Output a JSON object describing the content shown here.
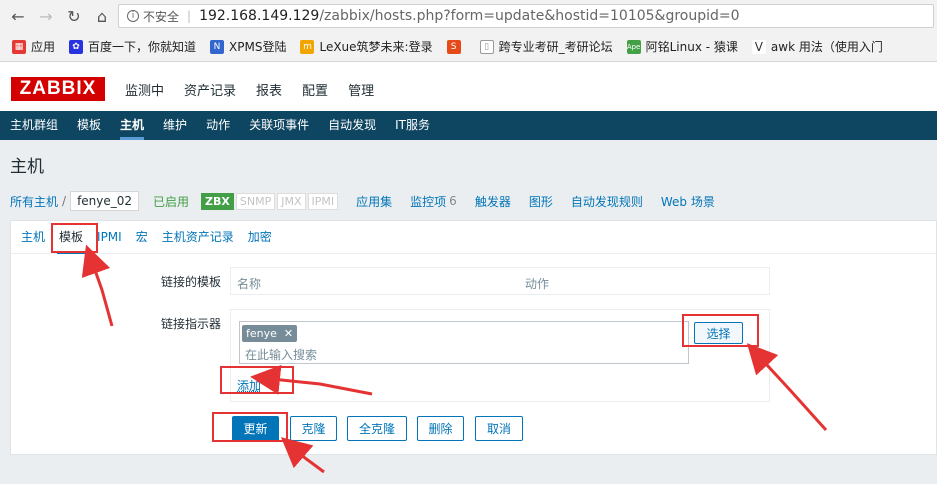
{
  "browser": {
    "insecure_label": "不安全",
    "url_host": "192.168.149.129",
    "url_path": "/zabbix/hosts.php?form=update&hostid=10105&groupid=0",
    "bookmarks": [
      {
        "label": "应用",
        "color": "#e53935",
        "icon": "apps-icon"
      },
      {
        "label": "百度一下，你就知道",
        "color": "#2932e1",
        "icon": "baidu-icon"
      },
      {
        "label": "XPMS登陆",
        "color": "#3366cc",
        "icon": "xpms-icon"
      },
      {
        "label": "LeXue筑梦未来:登录",
        "color": "#f1a500",
        "icon": "lexue-icon"
      },
      {
        "label": "",
        "color": "#e64a19",
        "icon": "site-icon"
      },
      {
        "label": "跨专业考研_考研论坛",
        "color": "#999999",
        "icon": "page-icon"
      },
      {
        "label": "阿铭Linux - 猿课",
        "color": "#43a047",
        "icon": "ape-icon"
      },
      {
        "label": "awk 用法（使用入门",
        "color": "#333333",
        "icon": "awk-icon"
      }
    ]
  },
  "logo": "ZABBIX",
  "topnav": [
    "监测中",
    "资产记录",
    "报表",
    "配置",
    "管理"
  ],
  "subnav": [
    "主机群组",
    "模板",
    "主机",
    "维护",
    "动作",
    "关联项事件",
    "自动发现",
    "IT服务"
  ],
  "page_title": "主机",
  "breadcrumb": {
    "all_hosts": "所有主机",
    "sep": "/",
    "current": "fenye_02",
    "enabled": "已启用",
    "zbx": "ZBX",
    "snmp": "SNMP",
    "jmx": "JMX",
    "ipmi": "IPMI",
    "links": [
      {
        "label": "应用集",
        "count": ""
      },
      {
        "label": "监控项",
        "count": "6"
      },
      {
        "label": "触发器",
        "count": ""
      },
      {
        "label": "图形",
        "count": ""
      },
      {
        "label": "自动发现规则",
        "count": ""
      },
      {
        "label": "Web 场景",
        "count": ""
      }
    ]
  },
  "form_tabs": [
    "主机",
    "模板",
    "IPMI",
    "宏",
    "主机资产记录",
    "加密"
  ],
  "form": {
    "linked_templates_label": "链接的模板",
    "col_name": "名称",
    "col_action": "动作",
    "link_indicator_label": "链接指示器",
    "chip": "fenye",
    "search_placeholder": "在此输入搜索",
    "select_button": "选择",
    "add_link": "添加"
  },
  "buttons": {
    "update": "更新",
    "clone": "克隆",
    "full_clone": "全克隆",
    "delete": "删除",
    "cancel": "取消"
  },
  "colors": {
    "accent": "#0275b8",
    "header_bar": "#0e4561",
    "logo_red": "#d40000",
    "annotation_red": "#e53333",
    "enabled_green": "#429e47"
  }
}
